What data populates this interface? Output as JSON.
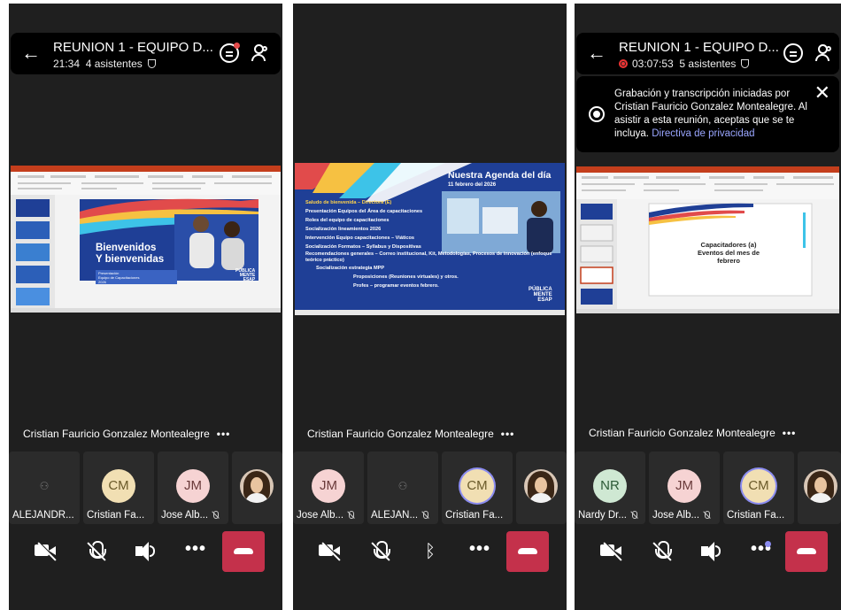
{
  "screens": [
    {
      "title": "REUNION 1 - EQUIPO D...",
      "time": "21:34",
      "attendees": "4 asistentes",
      "presenter": "Cristian Fauricio Gonzalez Montealegre",
      "slide": {
        "heading_1": "Bienvenidos",
        "heading_2": "Y bienvenidas",
        "box_line_1": "Presentación",
        "box_line_2": "Equipo de Capacitaciones",
        "box_line_3": "2026",
        "brand_1": "PÚBLICA",
        "brand_2": "MENTE",
        "brand_3": "ESAP"
      },
      "participants": [
        {
          "initials": "",
          "name": "ALEJANDR..."
        },
        {
          "initials": "CM",
          "name": "Cristian Fa..."
        },
        {
          "initials": "JM",
          "name": "Jose Alb..."
        },
        {
          "initials": "",
          "name": ""
        }
      ]
    },
    {
      "presenter": "Cristian Fauricio Gonzalez Montealegre",
      "slide": {
        "title": "Nuestra Agenda del día",
        "date": "11 febrero del 2026",
        "items": [
          "Saludo de bienvenida – Directora (E)",
          "Presentación Equipos del  Área de capacitaciones",
          "Roles del equipo de capacitaciones",
          "Socialización lineamientos 2026",
          "Intervención Equipo capacitaciones – Viáticos",
          "Socialización Formatos – Syllabus y Dispositivas",
          "Recomendaciones generales – Correo institucional, Kit, Metodologías, Procesos de innovación (enfoque teórico práctico)",
          "Socialización estrategia MPP",
          "Proposiciones (Reuniones virtuales) y otros.",
          "Profes – programar eventos febrero."
        ],
        "brand_1": "PÚBLICA",
        "brand_2": "MENTE",
        "brand_3": "ESAP"
      },
      "participants": [
        {
          "initials": "JM",
          "name": "Jose Alb..."
        },
        {
          "initials": "",
          "name": "ALEJAN..."
        },
        {
          "initials": "CM",
          "name": "Cristian Fa..."
        },
        {
          "initials": "",
          "name": ""
        }
      ]
    },
    {
      "title": "REUNION 1 - EQUIPO D...",
      "time": "03:07:53",
      "attendees": "5 asistentes",
      "notice": "Grabación y transcripción iniciadas por Cristian Fauricio Gonzalez Montealegre. Al asistir a esta reunión, aceptas que se te incluya.",
      "notice_link": "Directiva de privacidad",
      "presenter": "Cristian Fauricio Gonzalez Montealegre",
      "slide": {
        "line_1": "Capacitadores (a)",
        "line_2": "Eventos del mes de",
        "line_3": "febrero"
      },
      "participants": [
        {
          "initials": "NR",
          "name": "Nardy Dr..."
        },
        {
          "initials": "JM",
          "name": "Jose Alb..."
        },
        {
          "initials": "CM",
          "name": "Cristian Fa..."
        },
        {
          "initials": "",
          "name": ""
        }
      ]
    }
  ],
  "colors": {
    "background": "#1f1f1f",
    "end_call": "#c4314b",
    "accent": "#8b8cf0",
    "slide_blue": "#1f3f96"
  }
}
